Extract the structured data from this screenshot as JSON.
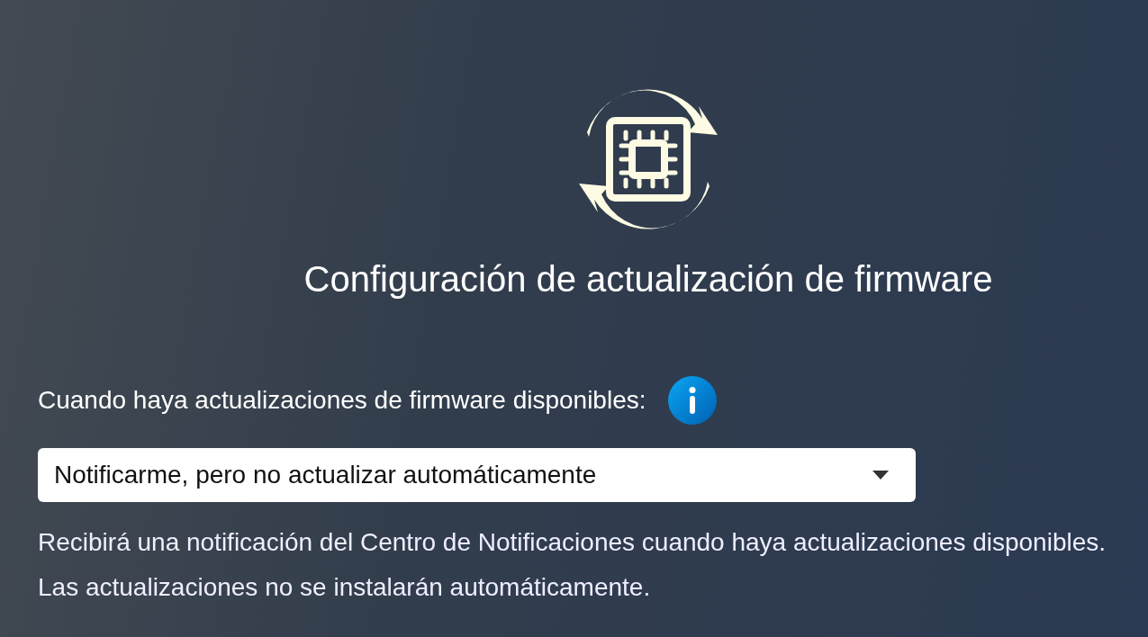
{
  "title": "Configuración de actualización de firmware",
  "setting": {
    "label": "Cuando haya actualizaciones de firmware disponibles:",
    "value": "Notificarme, pero no actualizar automáticamente",
    "description": "Recibirá una notificación del Centro de Notificaciones cuando haya actualizaciones disponibles. Las actualizaciones no se instalarán automáticamente."
  }
}
